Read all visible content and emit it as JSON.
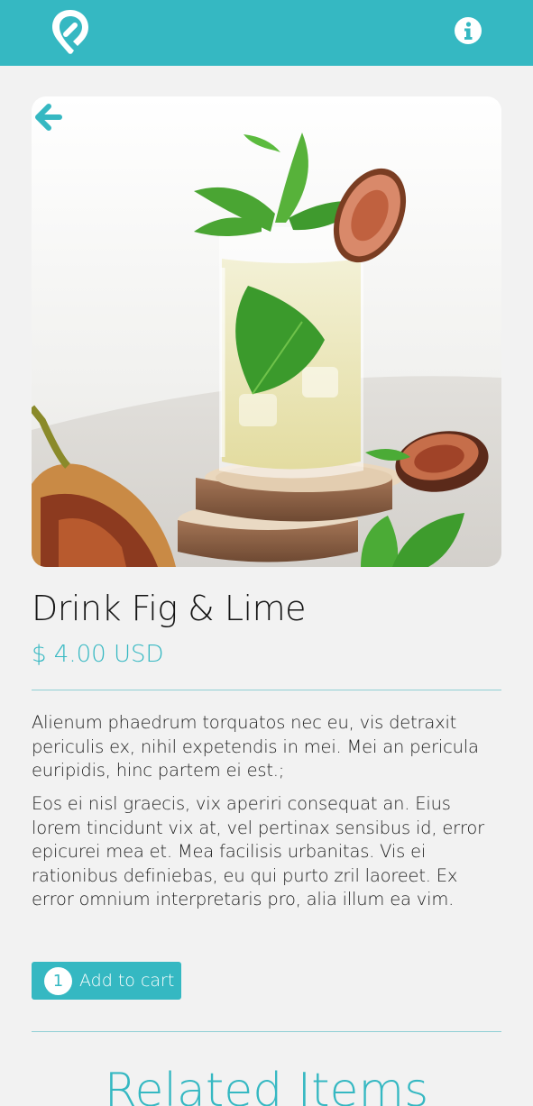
{
  "header": {
    "logo_icon": "map-pin-logo-icon",
    "info_icon": "info-circle-icon",
    "accent": "#35b8c2"
  },
  "product": {
    "image_alt": "Drink Fig & Lime",
    "back_icon": "arrow-left-icon",
    "title": "Drink Fig & Lime",
    "price": "$ 4.00 USD",
    "description": [
      "Alienum phaedrum torquatos nec eu, vis detraxit periculis ex, nihil expetendis in mei. Mei an pericula euripidis, hinc partem ei est.;",
      "Eos ei nisl graecis, vix aperiri consequat an. Eius lorem tincidunt vix at, vel pertinax sensibus id, error epicurei mea et. Mea facilisis urbanitas. Vis ei rationibus definiebas, eu qui purto zril laoreet. Ex error omnium interpretaris pro, alia illum ea vim."
    ]
  },
  "cart": {
    "quantity": "1",
    "label": "Add to cart"
  },
  "related": {
    "heading": "Related Items"
  }
}
